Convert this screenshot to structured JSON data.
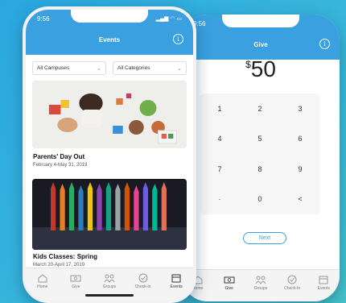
{
  "back_phone": {
    "time": "9:56",
    "title": "Give",
    "currency": "$",
    "amount": "50",
    "keypad": [
      "1",
      "2",
      "3",
      "4",
      "5",
      "6",
      "7",
      "8",
      "9",
      "",
      "0",
      "<"
    ],
    "next_label": "Next",
    "tabs": [
      "Home",
      "Give",
      "Groups",
      "Check-In",
      "Events"
    ],
    "active_tab": "Give"
  },
  "front_phone": {
    "time": "9:56",
    "title": "Events",
    "filters": {
      "campus": "All Campuses",
      "category": "All Categories"
    },
    "events": [
      {
        "title": "Parents' Day Out",
        "date": "February 4-May 31, 2019"
      },
      {
        "title": "Kids Classes: Spring",
        "date": "March 20-April 17, 2019"
      }
    ],
    "tabs": [
      "Home",
      "Give",
      "Groups",
      "Check-In",
      "Events"
    ],
    "active_tab": "Events"
  },
  "colors": {
    "accent": "#3aa0df",
    "background": "#2aa7e0"
  }
}
